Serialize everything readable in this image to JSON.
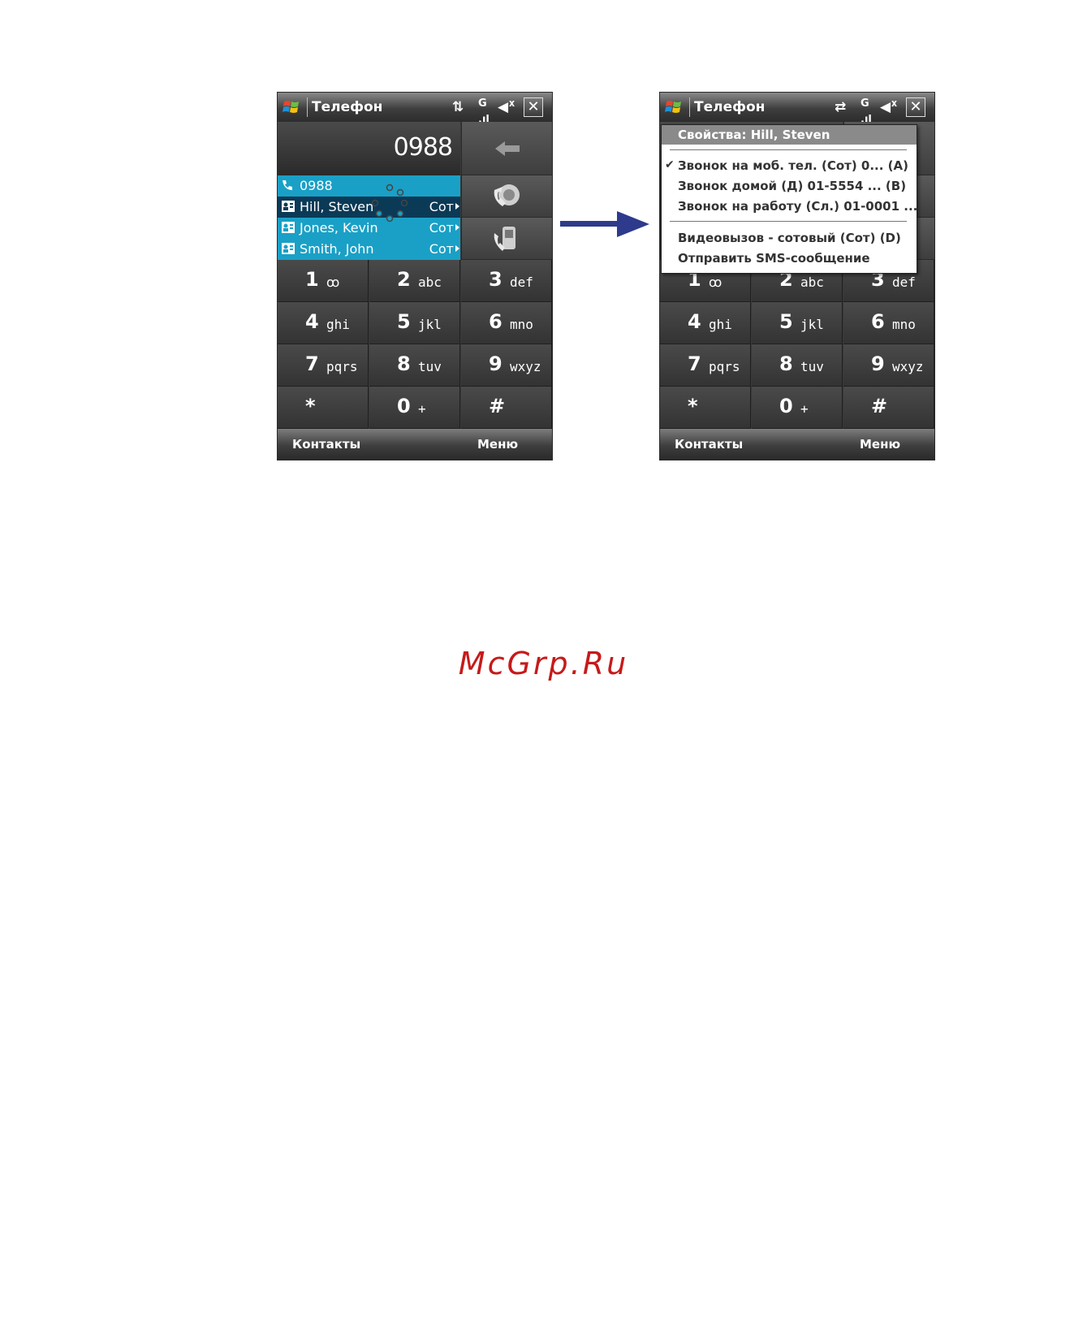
{
  "left_screen": {
    "title": "Телефон",
    "close_label": "✕",
    "display_number": "0988",
    "smart_list": [
      {
        "name": "0988",
        "type": "",
        "icon": "phone-call-icon",
        "selected": false
      },
      {
        "name": "Hill, Steven",
        "type": "Сот",
        "icon": "contact-card-icon",
        "selected": true
      },
      {
        "name": "Jones, Kevin",
        "type": "Сот",
        "icon": "contact-card-icon",
        "selected": false
      },
      {
        "name": "Smith, John",
        "type": "Сот",
        "icon": "contact-card-icon",
        "selected": false
      }
    ],
    "keys": [
      {
        "digit": "1",
        "letters": "ꝏ"
      },
      {
        "digit": "2",
        "letters": "abc"
      },
      {
        "digit": "3",
        "letters": "def"
      },
      {
        "digit": "4",
        "letters": "ghi"
      },
      {
        "digit": "5",
        "letters": "jkl"
      },
      {
        "digit": "6",
        "letters": "mno"
      },
      {
        "digit": "7",
        "letters": "pqrs"
      },
      {
        "digit": "8",
        "letters": "tuv"
      },
      {
        "digit": "9",
        "letters": "wxyz"
      },
      {
        "digit": "*",
        "letters": ""
      },
      {
        "digit": "0",
        "letters": "+"
      },
      {
        "digit": "#",
        "letters": ""
      }
    ],
    "softkeys": {
      "left": "Контакты",
      "right": "Меню"
    }
  },
  "right_screen": {
    "title": "Телефон",
    "close_label": "✕",
    "popup_menu": {
      "header": "Свойства: Hill, Steven",
      "items": [
        {
          "label": "Звонок на моб. тел. (Сот) 0...  (A)",
          "checked": true
        },
        {
          "label": "Звонок домой (Д) 01-5554 ...  (B)",
          "checked": false
        },
        {
          "label": "Звонок на работу (Сл.) 01-0001  ...",
          "checked": false
        }
      ],
      "items2": [
        {
          "label": "Видеовызов - сотовый (Сот)  (D)",
          "checked": false
        },
        {
          "label": "Отправить SMS-сообщение",
          "checked": false
        }
      ]
    },
    "keys": [
      {
        "digit": "1",
        "letters": "ꝏ"
      },
      {
        "digit": "2",
        "letters": "abc"
      },
      {
        "digit": "3",
        "letters": "def"
      },
      {
        "digit": "4",
        "letters": "ghi"
      },
      {
        "digit": "5",
        "letters": "jkl"
      },
      {
        "digit": "6",
        "letters": "mno"
      },
      {
        "digit": "7",
        "letters": "pqrs"
      },
      {
        "digit": "8",
        "letters": "tuv"
      },
      {
        "digit": "9",
        "letters": "wxyz"
      },
      {
        "digit": "*",
        "letters": ""
      },
      {
        "digit": "0",
        "letters": "+"
      },
      {
        "digit": "#",
        "letters": ""
      }
    ],
    "softkeys": {
      "left": "Контакты",
      "right": "Меню"
    }
  },
  "watermark": "McGrp.Ru",
  "colors": {
    "smartlist_bg": "#1aa0c6",
    "smartlist_selected": "#0b3a57",
    "arrow": "#2e3a8c",
    "watermark": "#c61a1a"
  }
}
